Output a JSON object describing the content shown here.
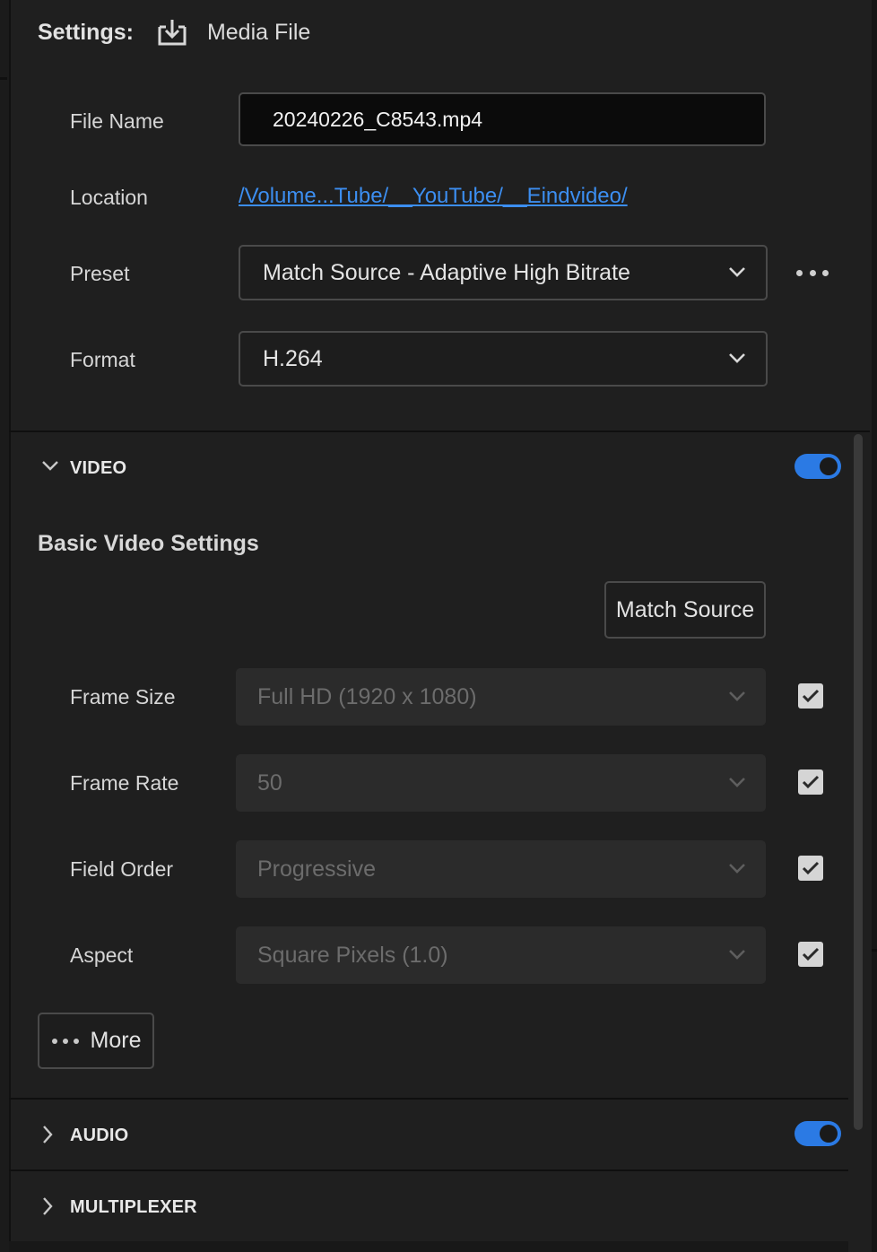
{
  "header": {
    "settings_label": "Settings:",
    "target_icon": "download-to-disk-icon",
    "target_label": "Media File"
  },
  "fields": {
    "file_name_label": "File Name",
    "file_name_value": "20240226_C8543.mp4",
    "location_label": "Location",
    "location_value": "/Volume...Tube/__YouTube/__Eindvideo/",
    "preset_label": "Preset",
    "preset_value": "Match Source - Adaptive High Bitrate",
    "format_label": "Format",
    "format_value": "H.264"
  },
  "video": {
    "title": "VIDEO",
    "enabled": true,
    "subheading": "Basic Video Settings",
    "match_source_label": "Match Source",
    "rows": [
      {
        "label": "Frame Size",
        "value": "Full HD (1920 x 1080)",
        "checked": true
      },
      {
        "label": "Frame Rate",
        "value": "50",
        "checked": true
      },
      {
        "label": "Field Order",
        "value": "Progressive",
        "checked": true
      },
      {
        "label": "Aspect",
        "value": "Square Pixels (1.0)",
        "checked": true
      }
    ],
    "more_label": "More"
  },
  "audio": {
    "title": "AUDIO",
    "enabled": true
  },
  "multiplexer": {
    "title": "MULTIPLEXER"
  },
  "colors": {
    "accent": "#2b7ae4",
    "link": "#3c8ef0",
    "background": "#1f1f1f"
  }
}
